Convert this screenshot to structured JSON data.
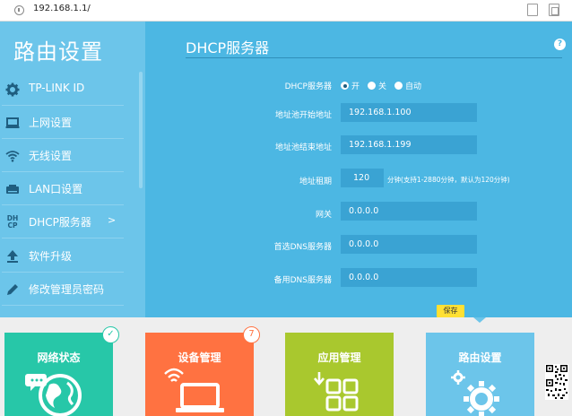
{
  "browser": {
    "url": "192.168.1.1/"
  },
  "sidebar": {
    "title": "路由设置",
    "items": [
      {
        "label": "TP-LINK ID",
        "icon": "gear-icon"
      },
      {
        "label": "上网设置",
        "icon": "monitor-icon"
      },
      {
        "label": "无线设置",
        "icon": "wifi-icon"
      },
      {
        "label": "LAN口设置",
        "icon": "lan-icon"
      },
      {
        "label": "DHCP服务器",
        "icon": "dhcp-icon",
        "active": true,
        "arrow": ">"
      },
      {
        "label": "软件升级",
        "icon": "upgrade-icon"
      },
      {
        "label": "修改管理员密码",
        "icon": "pencil-icon"
      }
    ],
    "dhcp_icon_text": [
      "DH",
      "CP"
    ]
  },
  "main": {
    "title": "DHCP服务器",
    "help": "?",
    "dhcp_server": {
      "label": "DHCP服务器",
      "options": [
        "开",
        "关",
        "自动"
      ],
      "selected": "开"
    },
    "fields": [
      {
        "label": "地址池开始地址",
        "value": "192.168.1.100"
      },
      {
        "label": "地址池结束地址",
        "value": "192.168.1.199"
      },
      {
        "label": "地址租期",
        "value": "120",
        "hint": "分钟(支持1-2880分钟，默认为120分钟)"
      },
      {
        "label": "网关",
        "value": "0.0.0.0"
      },
      {
        "label": "首选DNS服务器",
        "value": "0.0.0.0"
      },
      {
        "label": "备用DNS服务器",
        "value": "0.0.0.0"
      }
    ],
    "save_label": "保存"
  },
  "tiles": [
    {
      "label": "网络状态",
      "color": "#27c7a8",
      "badge": "✓",
      "icon": "globe-icon"
    },
    {
      "label": "设备管理",
      "color": "#ff7241",
      "badge": "7",
      "icon": "laptop-icon"
    },
    {
      "label": "应用管理",
      "color": "#a9c82e",
      "icon": "apps-icon"
    },
    {
      "label": "路由设置",
      "color": "#6cc5ea",
      "icon": "settings-gear-icon",
      "active": true
    }
  ],
  "colors": {
    "sidebar_bg": "#6cc5ea",
    "main_bg": "#4cb7e3",
    "input_bg": "#3aa3d3",
    "save_button": "#ffe033"
  }
}
